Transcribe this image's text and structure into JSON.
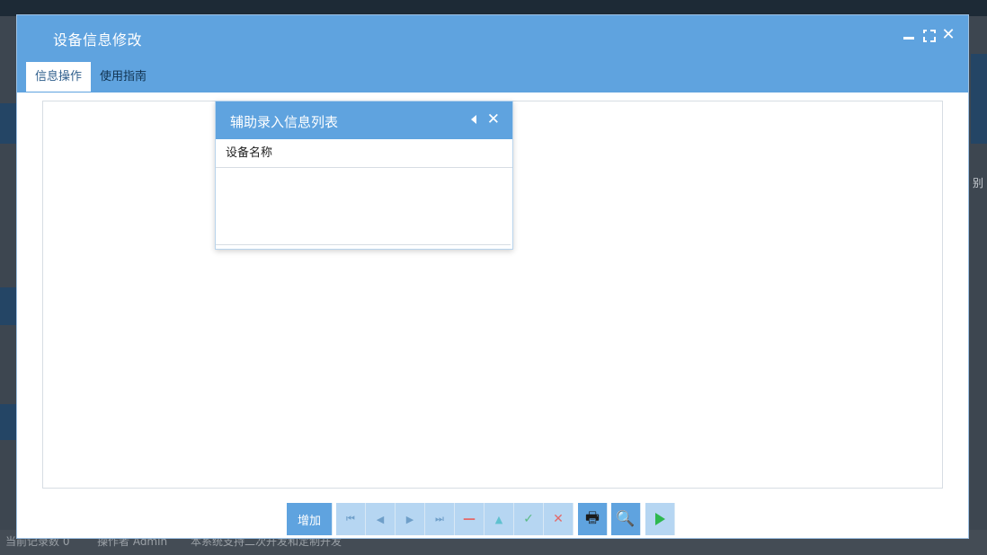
{
  "background": {
    "status_items": [
      "当前记录数 0",
      "操作者 Admin",
      "本系统支持二次开发和定制开发"
    ],
    "right_label": "别"
  },
  "dialog": {
    "title": "设备信息修改",
    "tabs": [
      {
        "label": "信息操作",
        "active": true
      },
      {
        "label": "使用指南",
        "active": false
      }
    ]
  },
  "popup": {
    "title": "辅助录入信息列表",
    "column_header": "设备名称",
    "rows": []
  },
  "toolbar": {
    "add_label": "增加",
    "nav_icons": {
      "first": "⏮",
      "prev": "◀",
      "next": "▶",
      "last": "⏭",
      "delete": "—",
      "up": "▲",
      "confirm": "✓",
      "cancel": "✕"
    },
    "print_icon": "🖶",
    "preview_icon": "🔍"
  },
  "colors": {
    "accent": "#5fa3df",
    "button_light": "#b6d6f2",
    "play_green": "#2eb84f"
  }
}
